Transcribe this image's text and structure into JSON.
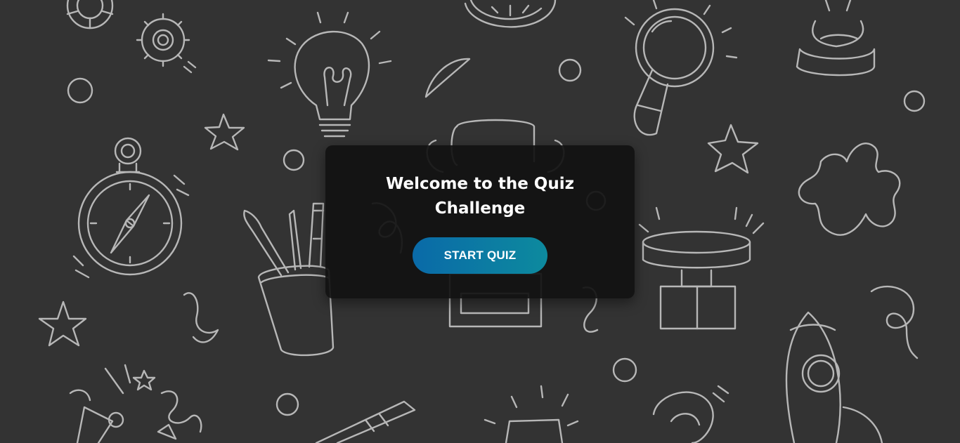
{
  "page": {
    "background_color": "#333333",
    "doodle_color": "#cfcfcf",
    "doodle_icons": [
      "gear-icon",
      "stopwatch-icon",
      "light-bulb-icon",
      "magnifying-glass-icon",
      "hourglass-icon",
      "compass-icon",
      "star-icon",
      "trophy-icon",
      "paint-cup-icon",
      "buzzer-icon",
      "puzzle-piece-icon",
      "rocket-icon",
      "party-popper-icon",
      "ribbon-icon"
    ]
  },
  "card": {
    "title": "Welcome to the Quiz Challenge",
    "background": "#121212"
  },
  "start_button": {
    "label": "START QUIZ",
    "gradient_start": "#0a6aa8",
    "gradient_end": "#0d8a9e"
  }
}
